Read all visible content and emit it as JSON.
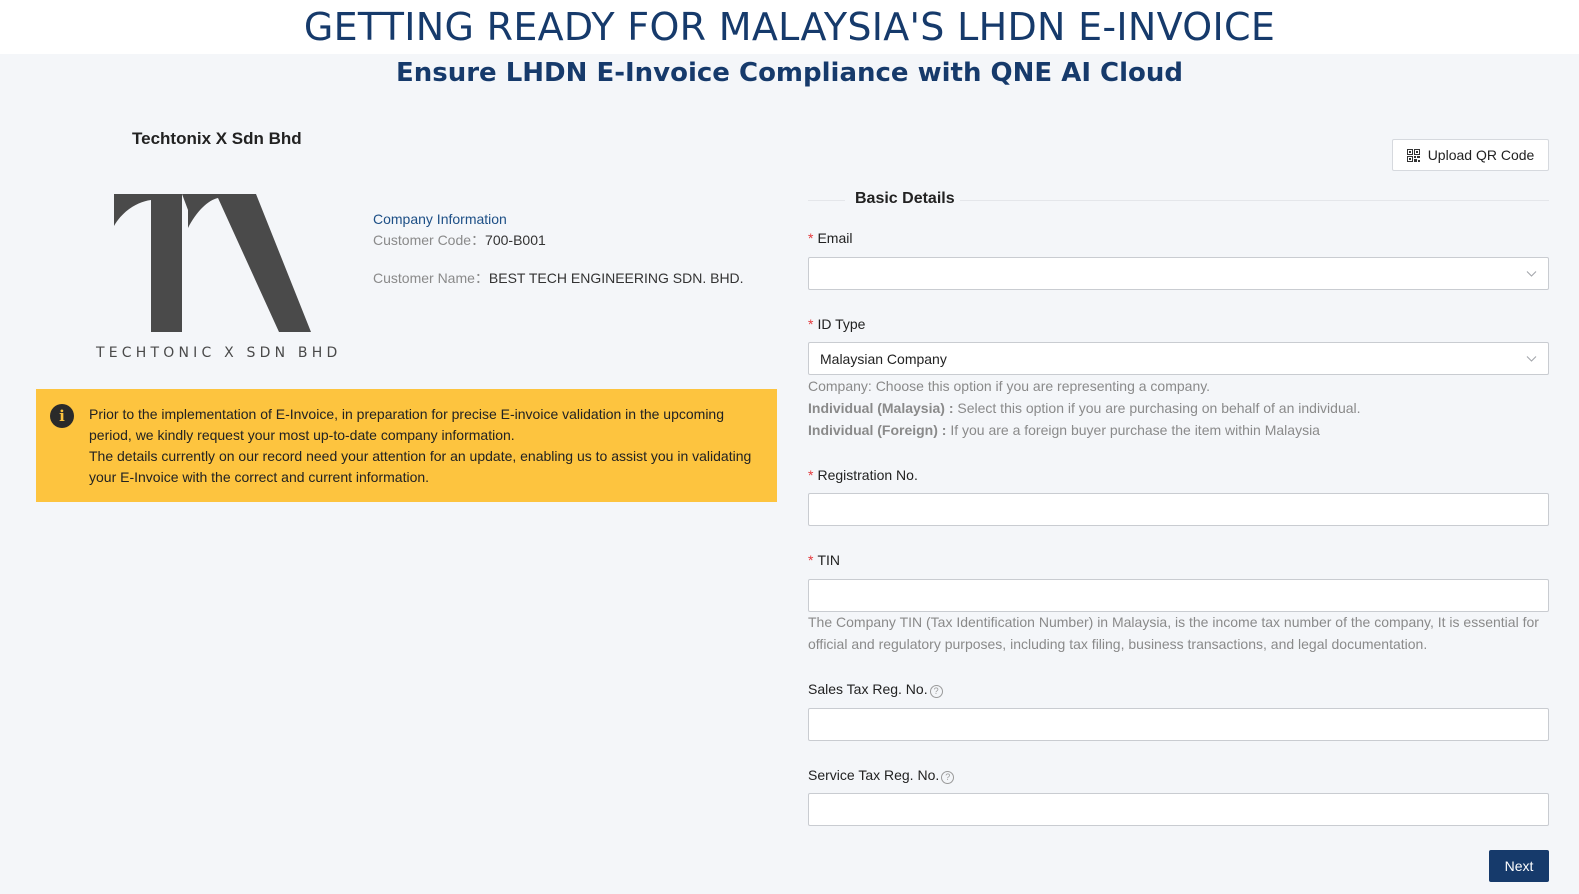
{
  "header": {
    "banner_title": "GETTING READY FOR MALAYSIA'S LHDN E-INVOICE",
    "subtitle": "Ensure LHDN E-Invoice Compliance with QNE AI Cloud"
  },
  "company": {
    "name": "Techtonix X Sdn Bhd",
    "logo_text": "TECHTONIC X SDN BHD",
    "info_heading": "Company Information",
    "customer_code_label": "Customer Code：",
    "customer_code": "700-B001",
    "customer_name_label": "Customer Name：",
    "customer_name": "BEST TECH ENGINEERING SDN. BHD."
  },
  "notice": {
    "icon": "info-icon",
    "paragraph1": "Prior to the implementation of E-Invoice, in preparation for precise E-invoice validation in the upcoming period, we kindly request your most up-to-date company information.",
    "paragraph2": "The details currently on our record need your attention for an update, enabling us to assist you in validating your E-Invoice with the correct and current information.",
    "background_color": "#fdc43f"
  },
  "upload": {
    "label": "Upload QR Code",
    "icon": "qr-code-icon"
  },
  "form": {
    "section_title": "Basic Details",
    "email": {
      "label": "Email",
      "value": "",
      "required": "*"
    },
    "id_type": {
      "label": "ID Type",
      "value": "Malaysian Company",
      "required": "*",
      "help_company": "Company: Choose this option if you are representing a company.",
      "help_ind_my_label": "Individual (Malaysia) :",
      "help_ind_my_text": " Select this option if you are purchasing on behalf of an individual.",
      "help_ind_foreign_label": "Individual (Foreign) :",
      "help_ind_foreign_text": " If you are a foreign buyer purchase the item within Malaysia"
    },
    "registration_no": {
      "label": "Registration No.",
      "value": "",
      "required": "*"
    },
    "tin": {
      "label": "TIN",
      "value": "",
      "required": "*",
      "help": "The Company TIN (Tax Identification Number) in Malaysia, is the income tax number of the company, It is essential for official and regulatory purposes, including tax filing, business transactions, and legal documentation."
    },
    "sales_tax": {
      "label": "Sales Tax Reg. No.",
      "value": ""
    },
    "service_tax": {
      "label": "Service Tax Reg. No.",
      "value": ""
    },
    "help_icon": "?",
    "next_label": "Next"
  },
  "colors": {
    "brand": "#163a6b",
    "required": "#e4393c",
    "page_bg": "#f4f6f9"
  }
}
